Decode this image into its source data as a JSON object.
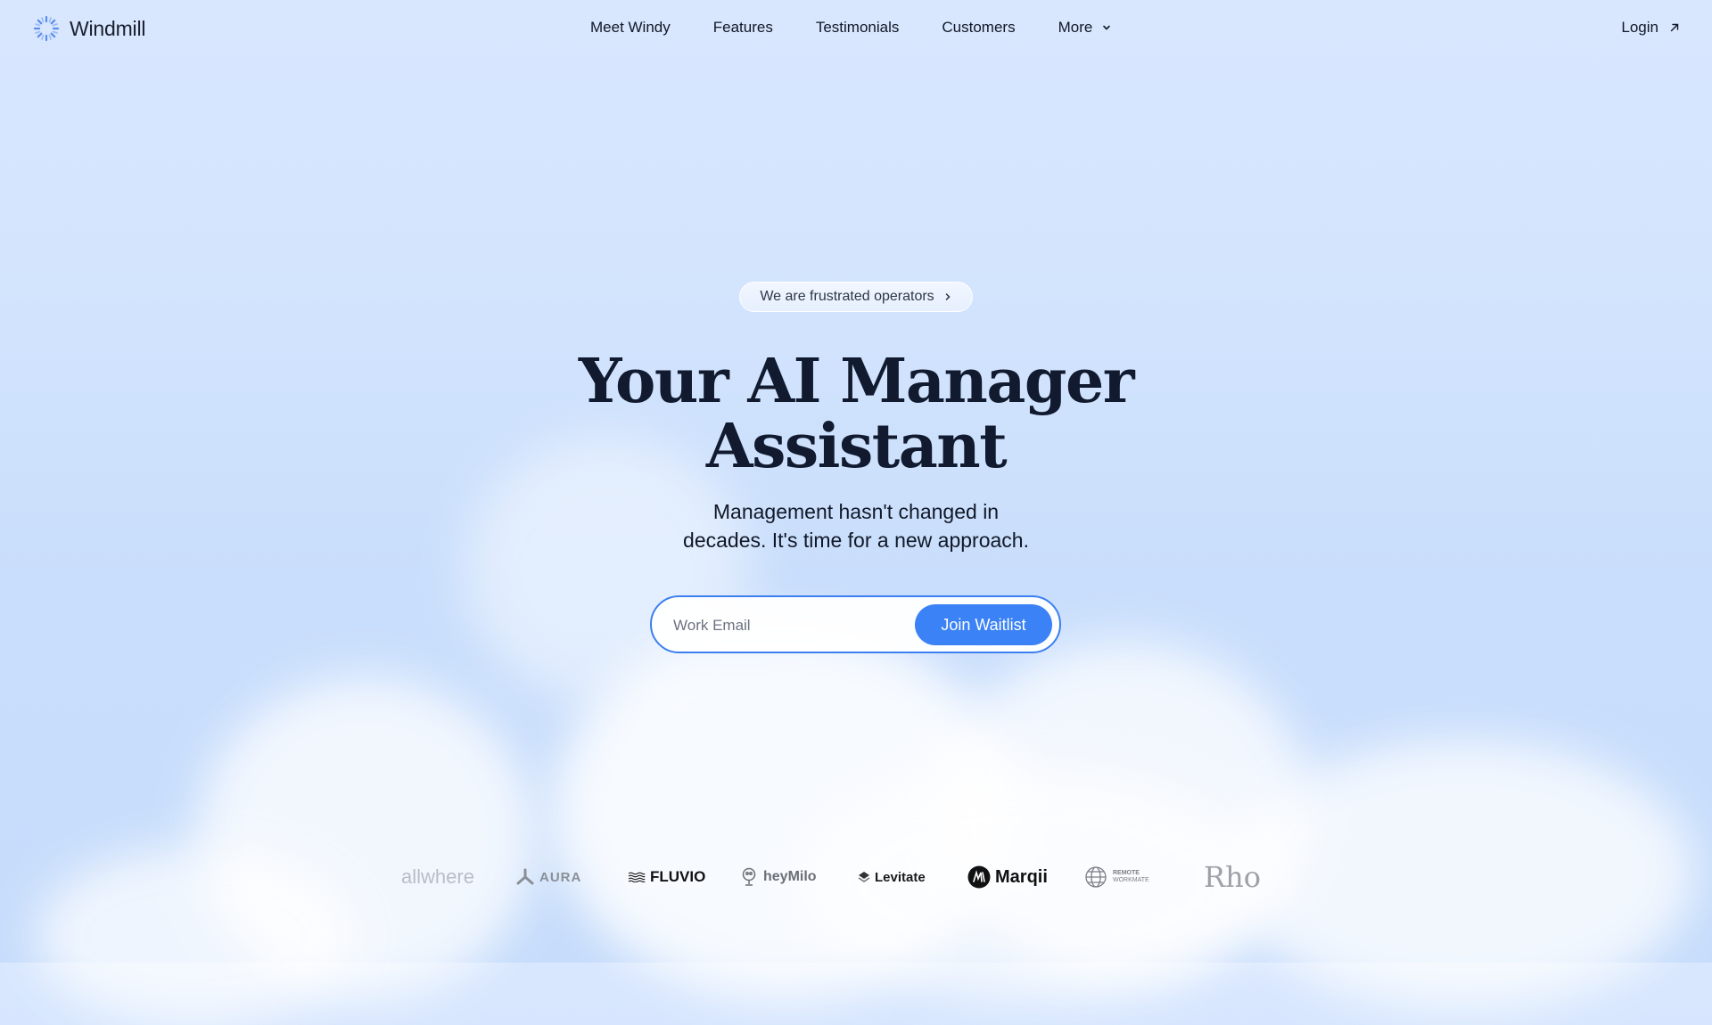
{
  "brand": {
    "name": "Windmill",
    "icon": "windmill-logo-icon",
    "accent": "#3b82f6"
  },
  "nav": {
    "links": [
      {
        "label": "Meet Windy"
      },
      {
        "label": "Features"
      },
      {
        "label": "Testimonials"
      },
      {
        "label": "Customers"
      },
      {
        "label": "More",
        "icon": "chevron-down-icon"
      }
    ],
    "login": {
      "label": "Login",
      "icon": "arrow-up-right-icon"
    }
  },
  "hero": {
    "pill": {
      "label": "We are frustrated operators",
      "icon": "chevron-right-icon"
    },
    "title_line1": "Your AI Manager",
    "title_line2": "Assistant",
    "subtitle_line1": "Management hasn't changed in",
    "subtitle_line2": "decades. It's time for a new approach.",
    "email_placeholder": "Work Email",
    "email_value": "",
    "cta_label": "Join Waitlist"
  },
  "customer_logos": [
    {
      "name": "allwhere",
      "text": "allwhere"
    },
    {
      "name": "aura",
      "text": "AURA"
    },
    {
      "name": "fluvio",
      "text": "FLUVIO"
    },
    {
      "name": "heymilo",
      "text": "heyMilo"
    },
    {
      "name": "levitate",
      "text": "Levitate"
    },
    {
      "name": "marqii",
      "text": "Marqii"
    },
    {
      "name": "remote-workmate",
      "line1": "REMOTE",
      "line2": "WORKMATE"
    },
    {
      "name": "rho",
      "text": "Rho"
    }
  ]
}
